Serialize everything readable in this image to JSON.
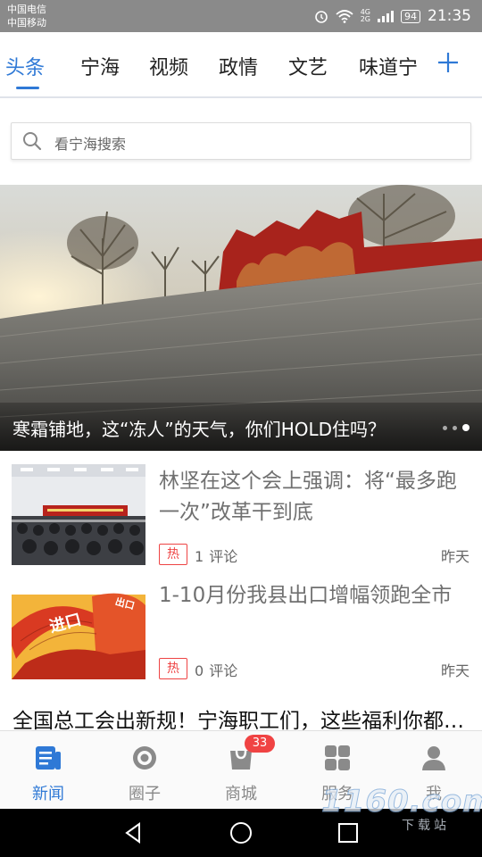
{
  "status_bar": {
    "carrier_1": "中国电信",
    "carrier_2": "中国移动",
    "network_1": "4G",
    "network_2": "2G",
    "battery": "94",
    "time": "21:35"
  },
  "tabs": {
    "items": [
      "头条",
      "宁海",
      "视频",
      "政情",
      "文艺",
      "味道宁"
    ],
    "active_index": 0,
    "add_icon": "plus-icon",
    "accent_color": "#2f79d6"
  },
  "search": {
    "placeholder": "看宁海搜索",
    "icon": "search-icon"
  },
  "banner": {
    "title": "寒霜铺地，这“冻人”的天气，你们HOLD住吗？",
    "active_dot": 2,
    "dot_count": 3
  },
  "news": [
    {
      "title": "林坚在这个会上强调：将“最多跑一次”改革干到底",
      "tag": "热",
      "comment_count": "1",
      "comment_label": "评论",
      "date": "昨天"
    },
    {
      "title": "1-10月份我县出口增幅领跑全市",
      "tag": "热",
      "comment_count": "0",
      "comment_label": "评论",
      "date": "昨天",
      "thumb_text_1": "进口",
      "thumb_text_2": "出口"
    }
  ],
  "headline": "全国总工会出新规！宁海职工们，这些福利你都知道吗",
  "bottom_nav": {
    "items": [
      {
        "label": "新闻",
        "icon": "news-icon"
      },
      {
        "label": "圈子",
        "icon": "circle-icon"
      },
      {
        "label": "商城",
        "icon": "shop-bag-icon",
        "badge": "33"
      },
      {
        "label": "服务",
        "icon": "grid-icon"
      },
      {
        "label": "我",
        "icon": "person-icon"
      }
    ],
    "active_index": 0
  },
  "watermark": {
    "brand": "1160.com",
    "text": "下载站"
  }
}
